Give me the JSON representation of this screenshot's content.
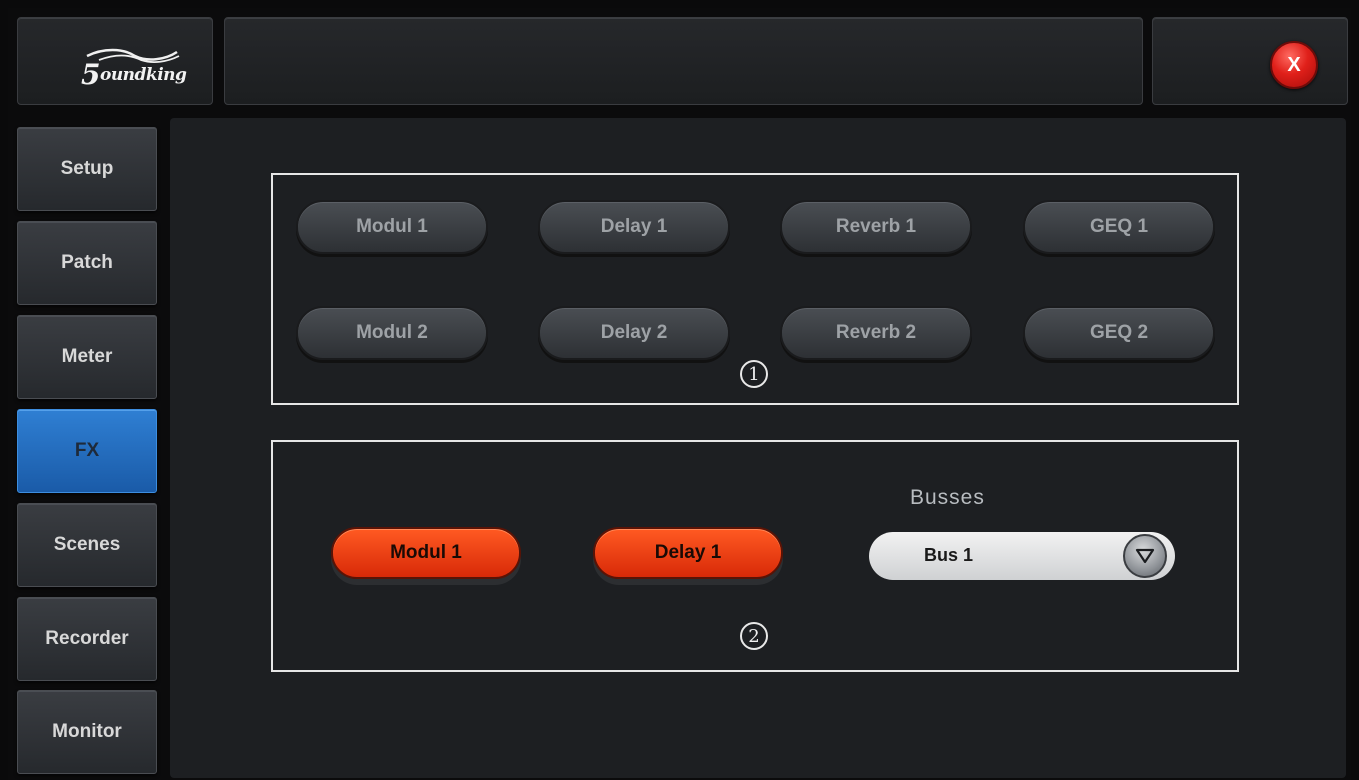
{
  "header": {
    "logo_text_initial": "5",
    "logo_text_rest": "oundking",
    "title": "",
    "close_label": "X"
  },
  "sidebar": {
    "items": [
      {
        "label": "Setup"
      },
      {
        "label": "Patch"
      },
      {
        "label": "Meter"
      },
      {
        "label": "FX",
        "active": true
      },
      {
        "label": "Scenes"
      },
      {
        "label": "Recorder"
      },
      {
        "label": "Monitor"
      }
    ]
  },
  "fx_units": {
    "row1": [
      "Modul 1",
      "Delay 1",
      "Reverb 1",
      "GEQ 1"
    ],
    "row2": [
      "Modul 2",
      "Delay 2",
      "Reverb 2",
      "GEQ 2"
    ],
    "marker": "1"
  },
  "assign": {
    "selected": [
      "Modul 1",
      "Delay 1"
    ],
    "busses_label": "Busses",
    "bus_value": "Bus 1",
    "marker": "2"
  },
  "colors": {
    "active_nav": "#1f66b8",
    "selected_fx": "#e83a10",
    "close_button": "#e0201a"
  }
}
